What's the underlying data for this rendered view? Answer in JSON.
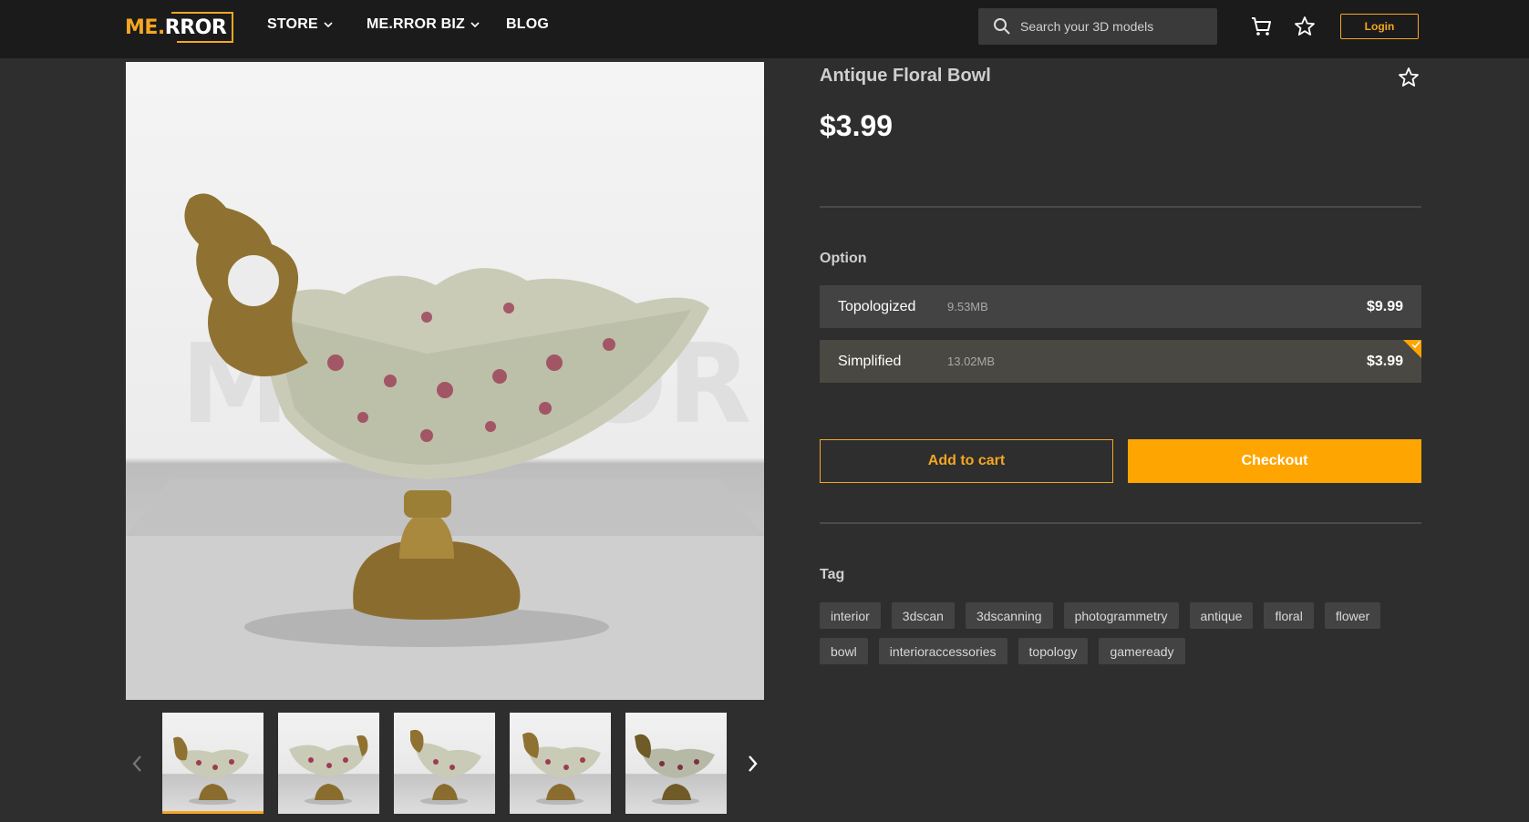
{
  "header": {
    "logo_left": "ME.",
    "logo_right": "RROR",
    "nav": [
      {
        "label": "STORE",
        "has_dropdown": true
      },
      {
        "label": "ME.RROR BIZ",
        "has_dropdown": true
      },
      {
        "label": "BLOG",
        "has_dropdown": false
      }
    ],
    "search_placeholder": "Search your 3D models",
    "cart_icon": "cart-icon",
    "favorites_icon": "star-outline-icon",
    "login_label": "Login"
  },
  "gallery": {
    "main_image_alt": "Antique floral bowl with gilded pedestal and ornate handle",
    "thumbnails_count": 5,
    "active_thumbnail": 0,
    "prev_icon": "chevron-left-icon",
    "next_icon": "chevron-right-icon"
  },
  "product": {
    "title": "Antique Floral Bowl",
    "price": "$3.99",
    "option_label": "Option",
    "options": [
      {
        "name": "Topologized",
        "size": "9.53MB",
        "price": "$9.99",
        "selected": false
      },
      {
        "name": "Simplified",
        "size": "13.02MB",
        "price": "$3.99",
        "selected": true
      }
    ],
    "add_to_cart_label": "Add to cart",
    "checkout_label": "Checkout",
    "tag_label": "Tag",
    "tags": [
      "interior",
      "3dscan",
      "3dscanning",
      "photogrammetry",
      "antique",
      "floral",
      "flower",
      "bowl",
      "interioraccessories",
      "topology",
      "gameready"
    ]
  },
  "colors": {
    "accent": "#fea502",
    "nav_bg": "#1b1b1b",
    "page_bg": "#2e2e2e",
    "option_bg": "#434343"
  }
}
